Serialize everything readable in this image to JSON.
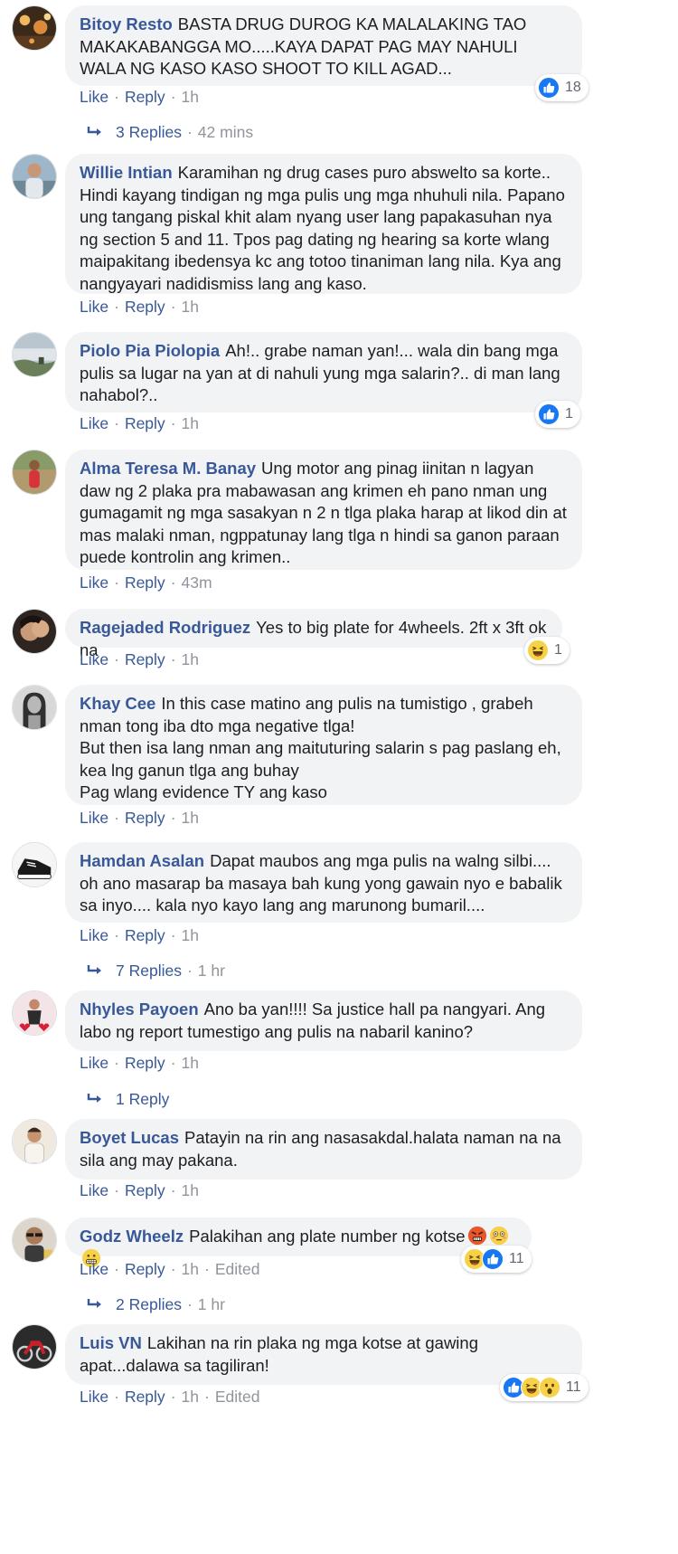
{
  "actions": {
    "like": "Like",
    "reply": "Reply",
    "dot": "·"
  },
  "colors": {
    "link": "#385898",
    "bubble": "#f2f3f5",
    "muted": "#90949c",
    "like_blue": "#1877f2"
  },
  "comments": [
    {
      "author": "Bitoy Resto",
      "text": "BASTA DRUG DUROG KA MALALAKING TAO MAKAKABANGGA MO.....KAYA DAPAT PAG MAY NAHULI WALA NG KASO KASO SHOOT TO KILL AGAD...",
      "time": "1h",
      "edited": "",
      "avatar_icon": "city-night-avatar-icon",
      "reactions": {
        "icons": [
          "like-reaction-icon"
        ],
        "count": "18"
      },
      "replies": {
        "label": "3 Replies",
        "time": "42 mins"
      }
    },
    {
      "author": "Willie Intian",
      "text": "Karamihan ng drug cases puro abswelto sa korte.. Hindi kayang tindigan ng mga pulis ung mga nhuhuli nila. Papano ung tangang piskal khit alam nyang user lang papakasuhan nya ng section 5 and 11. Tpos pag dating ng hearing sa korte wlang maipakitang ibedensya kc ang totoo tinaniman lang nila. Kya ang nangyayari nadidismiss lang ang kaso.",
      "time": "1h",
      "edited": "",
      "avatar_icon": "man-portrait-avatar-icon",
      "reactions": null,
      "replies": null
    },
    {
      "author": "Piolo Pia Piolopia",
      "text": "Ah!.. grabe naman yan!... wala din bang mga pulis sa lugar na yan at di nahuli yung mga salarin?.. di man lang nahabol?..",
      "time": "1h",
      "edited": "",
      "avatar_icon": "landscape-avatar-icon",
      "reactions": {
        "icons": [
          "like-reaction-icon"
        ],
        "count": "1"
      },
      "replies": null
    },
    {
      "author": "Alma Teresa M. Banay",
      "text": "Ung motor ang pinag iinitan n lagyan daw ng 2 plaka pra mabawasan ang krimen eh pano nman ung gumagamit ng mga sasakyan n 2 n tlga plaka harap at likod din at mas malaki nman, ngppatunay lang tlga n hindi sa ganon paraan puede kontrolin ang krimen..",
      "time": "43m",
      "edited": "",
      "avatar_icon": "woman-outdoor-avatar-icon",
      "reactions": null,
      "replies": null
    },
    {
      "author": "Ragejaded Rodriguez",
      "text": "Yes to big plate for 4wheels. 2ft x 3ft ok na",
      "time": "1h",
      "edited": "",
      "avatar_icon": "couple-avatar-icon",
      "reactions": {
        "icons": [
          "haha-reaction-icon"
        ],
        "count": "1"
      },
      "replies": null
    },
    {
      "author": "Khay Cee",
      "text": "In this case matino ang pulis na tumistigo , grabeh nman tong iba dto mga negative tlga!\nBut then isa lang nman ang maituturing salarin s pag paslang eh, kea lng ganun tlga ang buhay\nPag wlang evidence TY ang kaso",
      "time": "1h",
      "edited": "",
      "avatar_icon": "woman-grayscale-avatar-icon",
      "reactions": null,
      "replies": null
    },
    {
      "author": "Hamdan Asalan",
      "text": "Dapat maubos ang mga pulis na walng silbi.... oh ano masarap ba masaya bah kung yong gawain nyo e babalik sa inyo.... kala nyo kayo lang ang marunong bumaril....",
      "time": "1h",
      "edited": "",
      "avatar_icon": "sneaker-avatar-icon",
      "reactions": null,
      "replies": {
        "label": "7 Replies",
        "time": "1 hr"
      }
    },
    {
      "author": "Nhyles Payoen",
      "text": "Ano ba yan!!!! Sa justice hall pa nangyari. Ang labo ng report tumestigo ang pulis na nabaril kanino?",
      "time": "1h",
      "edited": "",
      "avatar_icon": "woman-hearts-avatar-icon",
      "reactions": null,
      "replies": {
        "label": "1 Reply",
        "time": ""
      }
    },
    {
      "author": "Boyet Lucas",
      "text": "Patayin na rin ang nasasakdal.halata naman na na sila ang may pakana.",
      "time": "1h",
      "edited": "",
      "avatar_icon": "man-light-avatar-icon",
      "reactions": null,
      "replies": null
    },
    {
      "author": "Godz Wheelz",
      "text": "Palakihan ang plate number ng kotse",
      "emoji_icons": [
        "angry-face-emoji-icon",
        "flushed-face-emoji-icon",
        "grimacing-face-emoji-icon"
      ],
      "time": "1h",
      "edited": "Edited",
      "avatar_icon": "man-glasses-avatar-icon",
      "reactions": {
        "icons": [
          "haha-reaction-icon",
          "like-reaction-icon"
        ],
        "count": "11"
      },
      "replies": {
        "label": "2 Replies",
        "time": "1 hr"
      }
    },
    {
      "author": "Luis VN",
      "text": "Lakihan na rin plaka ng mga kotse at gawing apat...dalawa sa tagiliran!",
      "time": "1h",
      "edited": "Edited",
      "avatar_icon": "motorcycle-avatar-icon",
      "reactions": {
        "icons": [
          "like-reaction-icon",
          "haha-reaction-icon",
          "wow-reaction-icon"
        ],
        "count": "11"
      },
      "replies": null
    }
  ]
}
